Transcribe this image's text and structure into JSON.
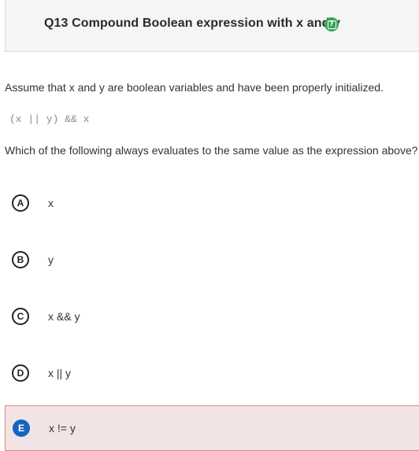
{
  "header": {
    "title": "Q13 Compound Boolean expression with x and y",
    "help_icon": "help-icon",
    "help_icon_color": "#3aa655"
  },
  "prompt": "Assume that x and y are boolean variables and have been properly initialized.",
  "code": "(x || y) && x",
  "question": "Which of the following always evaluates to the same value as the expression above?",
  "choices": [
    {
      "letter": "A",
      "text": "x",
      "selected": false
    },
    {
      "letter": "B",
      "text": "y",
      "selected": false
    },
    {
      "letter": "C",
      "text": "x && y",
      "selected": false
    },
    {
      "letter": "D",
      "text": "x || y",
      "selected": false
    },
    {
      "letter": "E",
      "text": "x != y",
      "selected": true
    }
  ],
  "colors": {
    "selected_bg": "#f2e4e4",
    "selected_border": "#d98a8a",
    "selected_badge": "#1565c0"
  }
}
